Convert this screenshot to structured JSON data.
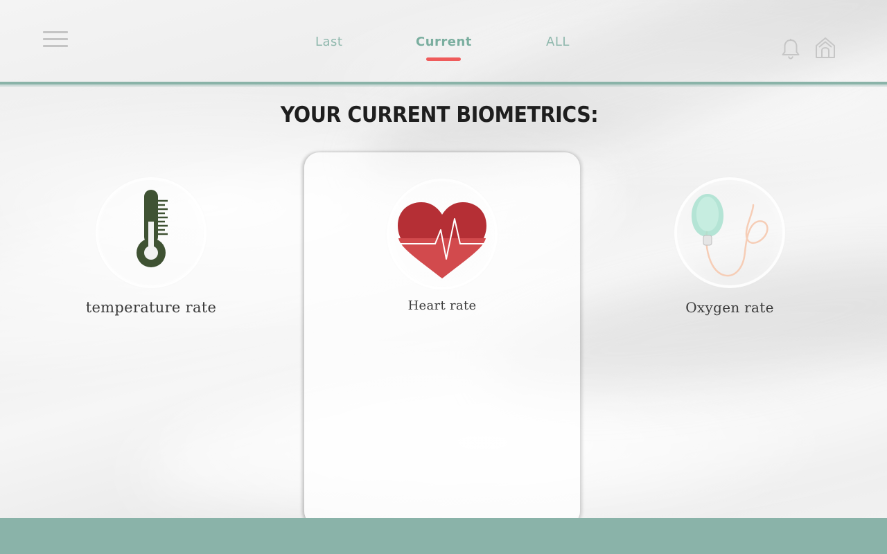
{
  "header": {
    "tabs": [
      {
        "label": "Last",
        "active": false
      },
      {
        "label": "Current",
        "active": true
      },
      {
        "label": "ALL",
        "active": false
      }
    ],
    "menu_icon": "hamburger-icon",
    "notification_icon": "bell-icon",
    "home_icon": "home-icon"
  },
  "main": {
    "title": "YOUR CURRENT BIOMETRICS:",
    "metrics": [
      {
        "label": "temperature rate",
        "icon": "thermometer-icon",
        "selected": false
      },
      {
        "label": "Heart rate",
        "icon": "heart-rate-icon",
        "selected": true
      },
      {
        "label": "Oxygen rate",
        "icon": "oxygen-mask-icon",
        "selected": false
      }
    ]
  },
  "colors": {
    "accent": "#8ab3a9",
    "tab_text": "#8fb8ad",
    "active_underline": "#ef5b5b",
    "heart_red": "#c5383d",
    "thermometer_green": "#3f5233",
    "title_text": "#1e1e1e"
  }
}
